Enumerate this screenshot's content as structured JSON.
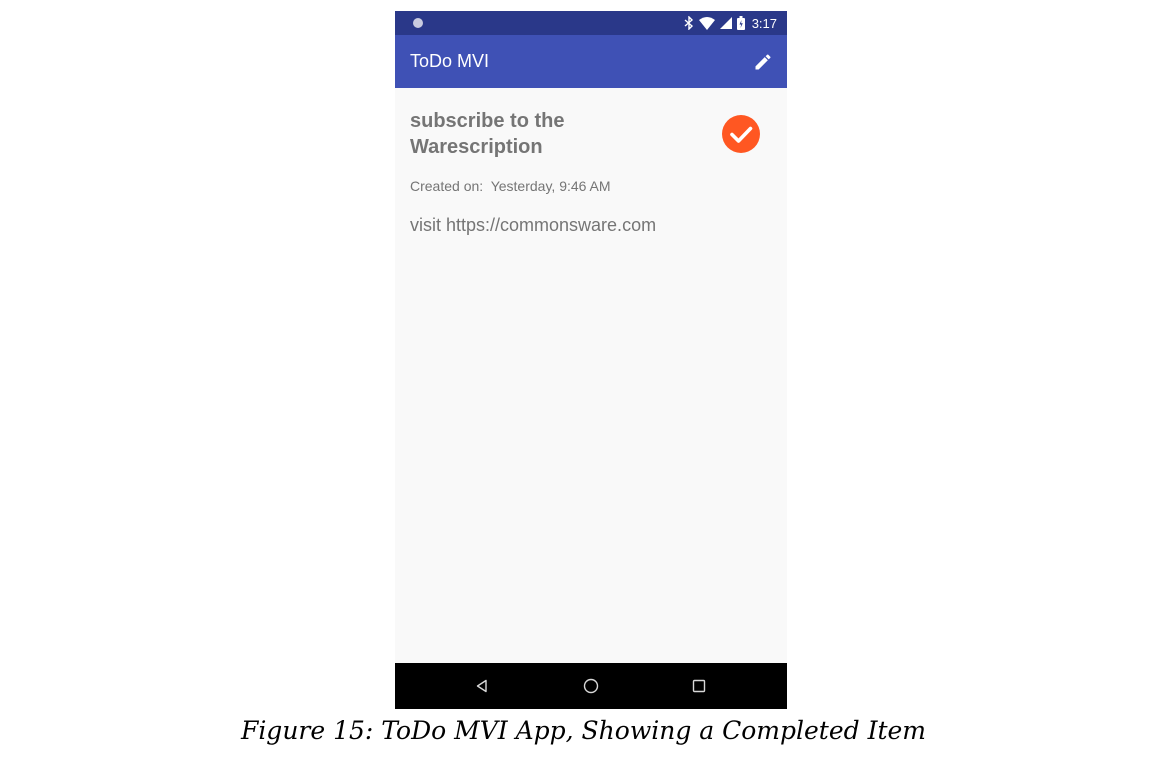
{
  "status_bar": {
    "time": "3:17",
    "icons": [
      "notification-dot-icon",
      "bluetooth-icon",
      "wifi-icon",
      "cell-signal-icon",
      "battery-icon"
    ]
  },
  "toolbar": {
    "title": "ToDo MVI",
    "edit_icon": "pencil-icon"
  },
  "item": {
    "title": "subscribe to the Warescription",
    "completed_icon": "check-circle-icon",
    "created_label": "Created on:",
    "created_value": "Yesterday, 9:46 AM",
    "notes": "visit https://commonsware.com"
  },
  "nav_bar": {
    "back_icon": "triangle-back-icon",
    "home_icon": "circle-home-icon",
    "recents_icon": "square-recents-icon"
  },
  "caption": "Figure 15: ToDo MVI App, Showing a Completed Item",
  "colors": {
    "status_bar": "#2a3889",
    "toolbar": "#3f51b5",
    "accent": "#ff5722",
    "text_secondary": "#757575",
    "background": "#f9f9f9"
  }
}
